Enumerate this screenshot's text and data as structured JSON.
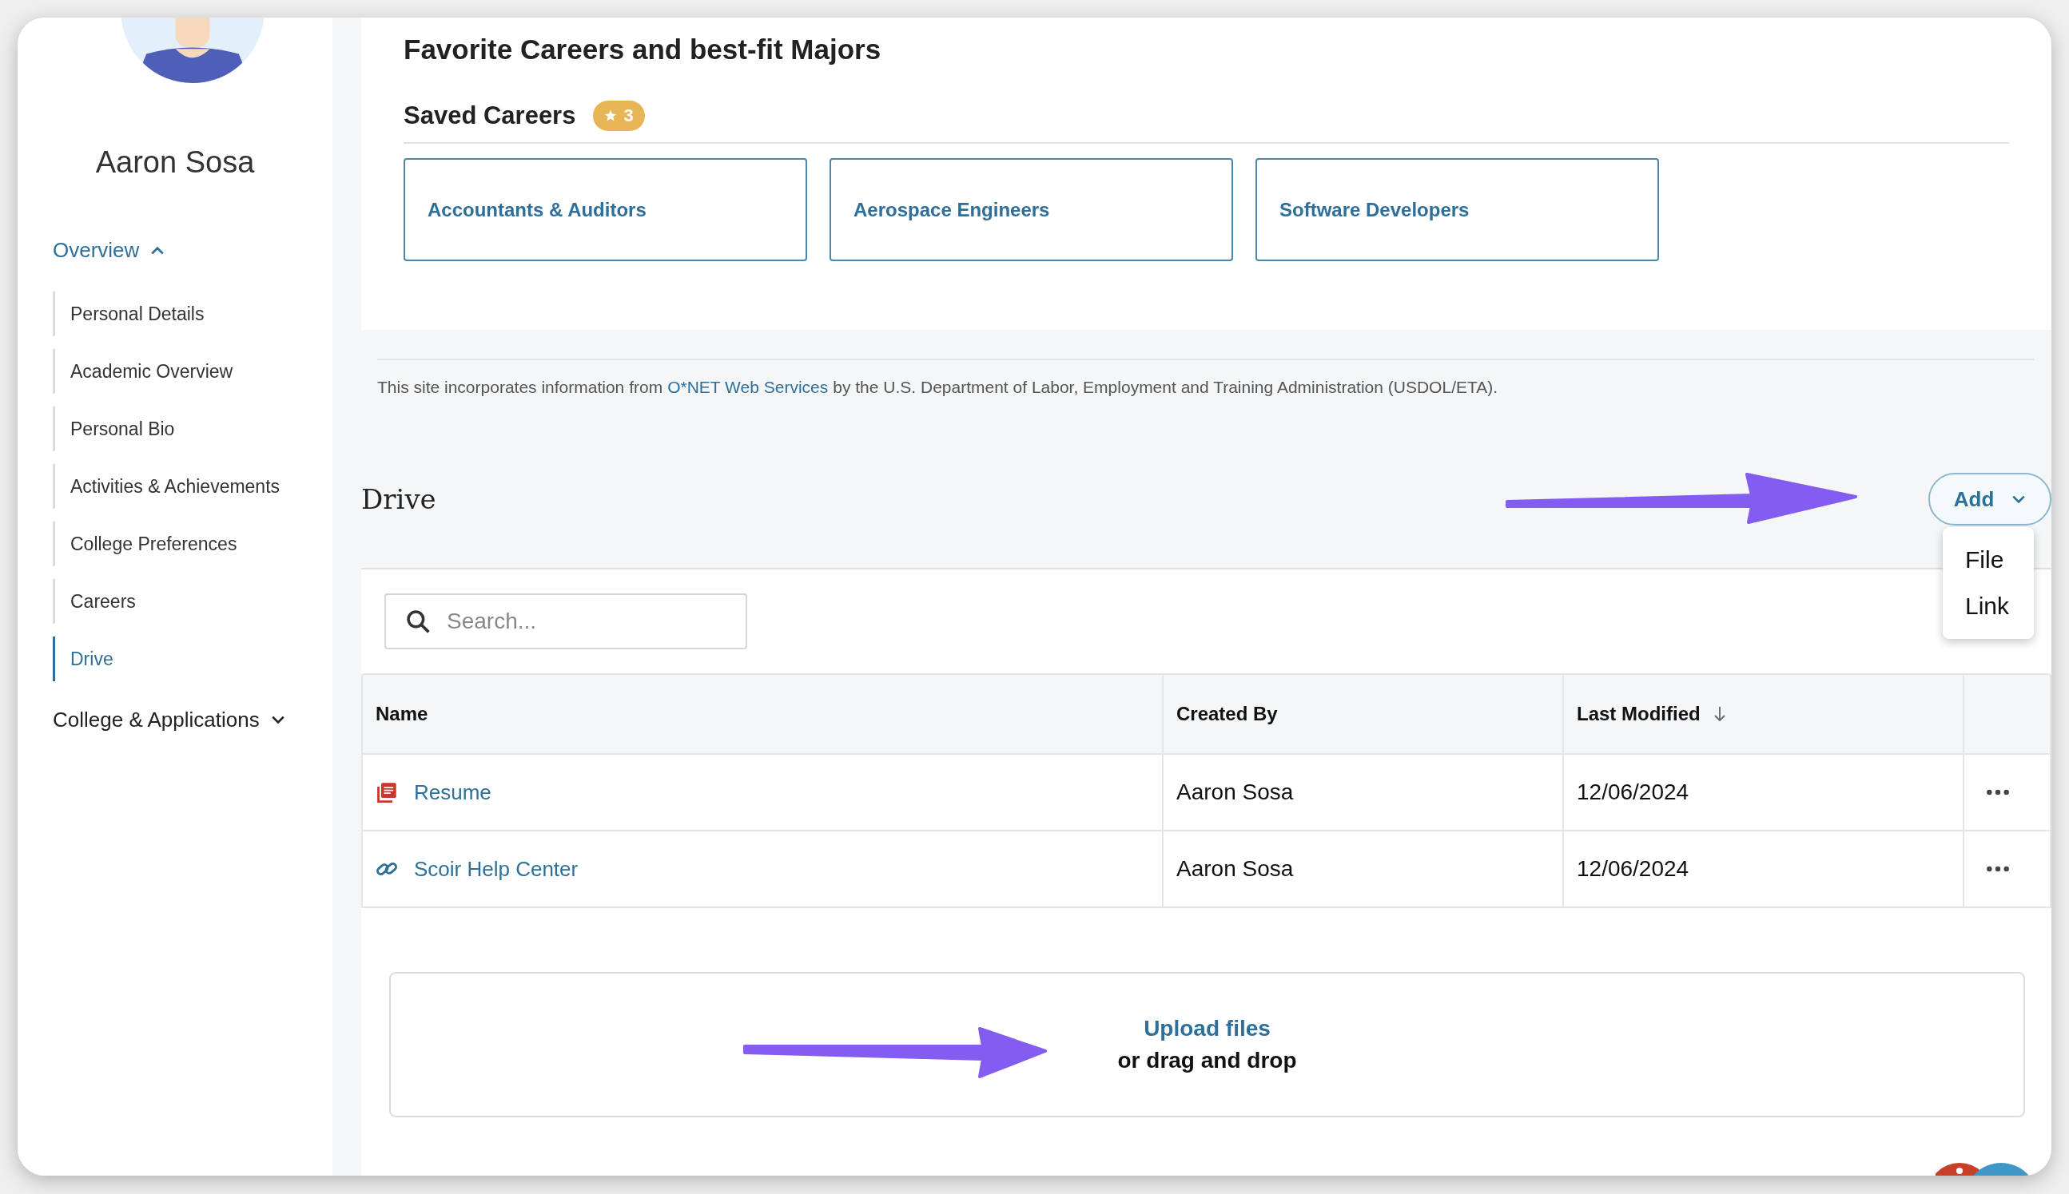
{
  "sidebar": {
    "user_name": "Aaron Sosa",
    "nav": [
      {
        "label": "Overview",
        "expanded": true,
        "children": [
          {
            "label": "Personal Details",
            "selected": false
          },
          {
            "label": "Academic Overview",
            "selected": false
          },
          {
            "label": "Personal Bio",
            "selected": false
          },
          {
            "label": "Activities & Achievements",
            "selected": false
          },
          {
            "label": "College Preferences",
            "selected": false
          },
          {
            "label": "Careers",
            "selected": false
          },
          {
            "label": "Drive",
            "selected": true
          }
        ]
      },
      {
        "label": "College & Applications",
        "expanded": false
      }
    ]
  },
  "favorites": {
    "title": "Favorite Careers and best-fit Majors",
    "saved_careers": {
      "title": "Saved Careers",
      "count": "3",
      "careers": [
        "Accountants & Auditors",
        "Aerospace Engineers",
        "Software Developers"
      ]
    }
  },
  "attribution": {
    "before": "This site incorporates information from",
    "link": "O*NET Web Services",
    "after": "by the U.S. Department of Labor, Employment and Training Administration (USDOL/ETA)."
  },
  "drive": {
    "title": "Drive",
    "add_button": {
      "label": "Add",
      "menu_open": true,
      "menu": [
        "File",
        "Link"
      ]
    },
    "search": {
      "placeholder": "Search..."
    },
    "table": {
      "columns": [
        {
          "label": "Name",
          "sorted": false
        },
        {
          "label": "Created By",
          "sorted": false
        },
        {
          "label": "Last Modified",
          "sorted": true
        }
      ],
      "rows": [
        {
          "name": "Resume",
          "kind": "pdf",
          "created_by": "Aaron Sosa",
          "modified": "12/06/2024"
        },
        {
          "name": "Scoir Help Center",
          "kind": "link",
          "created_by": "Aaron Sosa",
          "modified": "12/06/2024"
        }
      ]
    },
    "upload": {
      "link": "Upload files",
      "text": "or drag and drop"
    }
  }
}
